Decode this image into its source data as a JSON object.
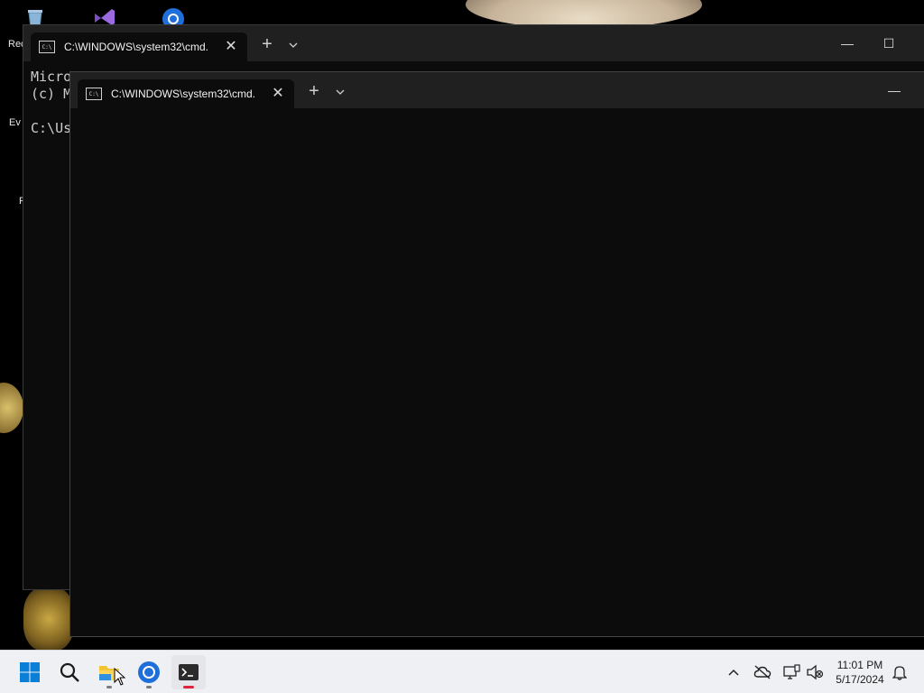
{
  "desktop": {
    "labels": [
      "Rec",
      "Ev",
      "F"
    ]
  },
  "terminal_back": {
    "tab_title": "C:\\WINDOWS\\system32\\cmd.",
    "close_glyph": "✕",
    "new_tab_glyph": "+",
    "minimize_glyph": "—",
    "maximize_glyph": "☐",
    "lines": [
      "Micro",
      "(c) M",
      "",
      "C:\\Us"
    ]
  },
  "terminal_front": {
    "tab_title": "C:\\WINDOWS\\system32\\cmd.",
    "close_glyph": "✕",
    "new_tab_glyph": "+",
    "minimize_glyph": "—"
  },
  "taskbar": {
    "time": "11:01 PM",
    "date": "5/17/2024",
    "apps": [
      {
        "name": "start",
        "icon": "windows-logo-icon"
      },
      {
        "name": "search",
        "icon": "search-icon"
      },
      {
        "name": "file-explorer",
        "icon": "folder-icon"
      },
      {
        "name": "chrome",
        "icon": "chrome-icon"
      },
      {
        "name": "terminal",
        "icon": "terminal-icon"
      }
    ],
    "tray_icons": [
      "chevron-up-icon",
      "cloud-off-icon",
      "network-icon",
      "volume-muted-icon",
      "notification-bell-icon"
    ]
  },
  "colors": {
    "terminal_bg": "#0c0c0c",
    "titlebar_bg": "#202020",
    "taskbar_bg": "#eef0f3",
    "active_indicator": "#e0243b",
    "windows_blue": "#0078d4"
  }
}
